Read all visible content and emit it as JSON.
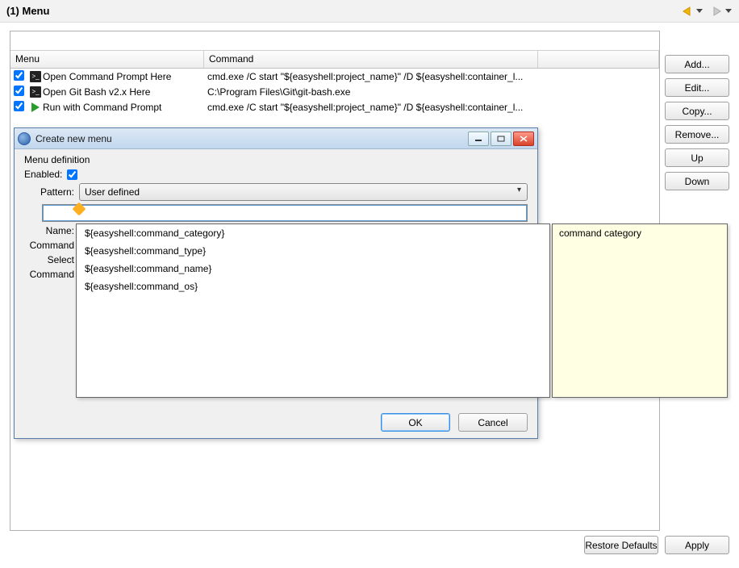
{
  "title": "(1) Menu",
  "nav": {
    "back_color": "#f4b400",
    "forward_color": "#999"
  },
  "table": {
    "headers": {
      "menu": "Menu",
      "command": "Command"
    },
    "rows": [
      {
        "checked": true,
        "icon": "cmd",
        "menu": "Open Command Prompt Here",
        "command": "cmd.exe /C start \"${easyshell:project_name}\" /D ${easyshell:container_l..."
      },
      {
        "checked": true,
        "icon": "cmd",
        "menu": "Open Git Bash v2.x Here",
        "command": "C:\\Program Files\\Git\\git-bash.exe"
      },
      {
        "checked": true,
        "icon": "run",
        "menu": "Run with Command Prompt",
        "command": "cmd.exe /C start \"${easyshell:project_name}\" /D ${easyshell:container_l..."
      }
    ]
  },
  "side_buttons": {
    "add": "Add...",
    "edit": "Edit...",
    "copy": "Copy...",
    "remove": "Remove...",
    "up": "Up",
    "down": "Down"
  },
  "dialog": {
    "title": "Create new menu",
    "section": "Menu definition",
    "enabled_label": "Enabled:",
    "enabled": true,
    "pattern_label": "Pattern:",
    "pattern_value": "User defined",
    "name_label": "Name:",
    "command_label": "Command",
    "select_label": "Select",
    "command2_label": "Command",
    "ok": "OK",
    "cancel": "Cancel"
  },
  "autocomplete": {
    "items": [
      "${easyshell:command_category}",
      "${easyshell:command_type}",
      "${easyshell:command_name}",
      "${easyshell:command_os}"
    ],
    "tooltip": "command category"
  },
  "bottom": {
    "restore": "Restore Defaults",
    "apply": "Apply"
  }
}
